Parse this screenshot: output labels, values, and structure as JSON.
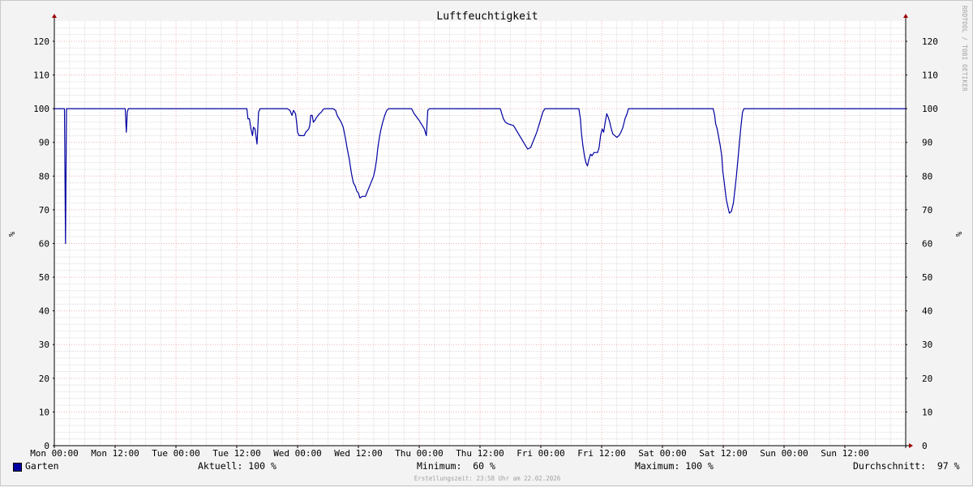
{
  "chart_data": {
    "type": "line",
    "title": "Luftfeuchtigkeit",
    "ylabel": "%",
    "ylim": [
      0,
      126
    ],
    "yticks": [
      0,
      10,
      20,
      30,
      40,
      50,
      60,
      70,
      80,
      90,
      100,
      110,
      120
    ],
    "xlim": [
      0,
      168
    ],
    "xunit": "hours since Mon 00:00",
    "xticks": [
      {
        "x": 0,
        "label": "Mon 00:00"
      },
      {
        "x": 12,
        "label": "Mon 12:00"
      },
      {
        "x": 24,
        "label": "Tue 00:00"
      },
      {
        "x": 36,
        "label": "Tue 12:00"
      },
      {
        "x": 48,
        "label": "Wed 00:00"
      },
      {
        "x": 60,
        "label": "Wed 12:00"
      },
      {
        "x": 72,
        "label": "Thu 00:00"
      },
      {
        "x": 84,
        "label": "Thu 12:00"
      },
      {
        "x": 96,
        "label": "Fri 00:00"
      },
      {
        "x": 108,
        "label": "Fri 12:00"
      },
      {
        "x": 120,
        "label": "Sat 00:00"
      },
      {
        "x": 132,
        "label": "Sat 12:00"
      },
      {
        "x": 144,
        "label": "Sun 00:00"
      },
      {
        "x": 156,
        "label": "Sun 12:00"
      }
    ],
    "grid": true,
    "legend_position": "bottom-left",
    "series": [
      {
        "name": "Garten",
        "color": "#0000a0",
        "points": [
          [
            0,
            100
          ],
          [
            2.0,
            100
          ],
          [
            2.2,
            60
          ],
          [
            2.4,
            100
          ],
          [
            14.0,
            100
          ],
          [
            14.2,
            93
          ],
          [
            14.4,
            99
          ],
          [
            14.6,
            100
          ],
          [
            38.0,
            100
          ],
          [
            38.2,
            97
          ],
          [
            38.5,
            97
          ],
          [
            38.8,
            94
          ],
          [
            39.1,
            92
          ],
          [
            39.3,
            94.5
          ],
          [
            39.6,
            94
          ],
          [
            40.0,
            89.5
          ],
          [
            40.3,
            99
          ],
          [
            40.6,
            100
          ],
          [
            46.0,
            100
          ],
          [
            46.5,
            99.5
          ],
          [
            46.9,
            98
          ],
          [
            47.2,
            99.5
          ],
          [
            47.6,
            98.5
          ],
          [
            47.8,
            96
          ],
          [
            48.0,
            93
          ],
          [
            48.3,
            92
          ],
          [
            49.3,
            92
          ],
          [
            49.6,
            93
          ],
          [
            50.2,
            94
          ],
          [
            50.4,
            95
          ],
          [
            50.6,
            98
          ],
          [
            50.9,
            98
          ],
          [
            51.1,
            96
          ],
          [
            51.4,
            96.5
          ],
          [
            51.8,
            97.5
          ],
          [
            52.3,
            98.5
          ],
          [
            52.7,
            99
          ],
          [
            53.0,
            99.7
          ],
          [
            53.3,
            100
          ],
          [
            55.0,
            100
          ],
          [
            55.5,
            99.5
          ],
          [
            55.8,
            98
          ],
          [
            56.2,
            97
          ],
          [
            56.6,
            96
          ],
          [
            57.0,
            94.5
          ],
          [
            57.4,
            91.5
          ],
          [
            57.8,
            88
          ],
          [
            58.2,
            85
          ],
          [
            58.6,
            81
          ],
          [
            59.0,
            78
          ],
          [
            59.4,
            77
          ],
          [
            59.7,
            75.5
          ],
          [
            60.0,
            75
          ],
          [
            60.3,
            73.5
          ],
          [
            60.8,
            74
          ],
          [
            61.4,
            74
          ],
          [
            61.8,
            75.5
          ],
          [
            62.2,
            77
          ],
          [
            62.6,
            78.5
          ],
          [
            63.0,
            80
          ],
          [
            63.3,
            82
          ],
          [
            63.6,
            85
          ],
          [
            63.8,
            88
          ],
          [
            64.1,
            91
          ],
          [
            64.4,
            93.5
          ],
          [
            64.8,
            96
          ],
          [
            65.2,
            98
          ],
          [
            65.6,
            99.5
          ],
          [
            66.0,
            100
          ],
          [
            70.5,
            100
          ],
          [
            71.0,
            98.5
          ],
          [
            71.5,
            97.5
          ],
          [
            72.0,
            96.5
          ],
          [
            72.6,
            95
          ],
          [
            73.0,
            94
          ],
          [
            73.4,
            92
          ],
          [
            73.7,
            99.5
          ],
          [
            74.0,
            100
          ],
          [
            88.0,
            100
          ],
          [
            88.3,
            98.5
          ],
          [
            88.6,
            97
          ],
          [
            89.0,
            96
          ],
          [
            89.5,
            95.5
          ],
          [
            90.6,
            95
          ],
          [
            91.0,
            94
          ],
          [
            91.4,
            93
          ],
          [
            91.8,
            92
          ],
          [
            92.2,
            91
          ],
          [
            92.6,
            90
          ],
          [
            93.0,
            89
          ],
          [
            93.4,
            88
          ],
          [
            94.0,
            88.5
          ],
          [
            94.4,
            90
          ],
          [
            94.8,
            91.5
          ],
          [
            95.2,
            93
          ],
          [
            95.6,
            95
          ],
          [
            96.0,
            97
          ],
          [
            96.4,
            99
          ],
          [
            96.8,
            100
          ],
          [
            103.5,
            100
          ],
          [
            103.8,
            97
          ],
          [
            104.0,
            93
          ],
          [
            104.3,
            89
          ],
          [
            104.6,
            86
          ],
          [
            104.9,
            84
          ],
          [
            105.2,
            83
          ],
          [
            105.5,
            85
          ],
          [
            105.8,
            86.5
          ],
          [
            106.1,
            86
          ],
          [
            106.5,
            87
          ],
          [
            107.2,
            87
          ],
          [
            107.5,
            88.5
          ],
          [
            107.8,
            92
          ],
          [
            108.1,
            94
          ],
          [
            108.4,
            93
          ],
          [
            108.7,
            96
          ],
          [
            109.0,
            98.5
          ],
          [
            109.3,
            97.5
          ],
          [
            109.6,
            96
          ],
          [
            109.9,
            94
          ],
          [
            110.2,
            92.5
          ],
          [
            110.6,
            92
          ],
          [
            111.0,
            91.5
          ],
          [
            111.4,
            92
          ],
          [
            111.8,
            93
          ],
          [
            112.2,
            94.5
          ],
          [
            112.6,
            97
          ],
          [
            113.0,
            98.5
          ],
          [
            113.3,
            100
          ],
          [
            130.0,
            100
          ],
          [
            130.3,
            98
          ],
          [
            130.5,
            95.5
          ],
          [
            130.8,
            94
          ],
          [
            131.1,
            91.5
          ],
          [
            131.4,
            89
          ],
          [
            131.7,
            86
          ],
          [
            131.9,
            81.5
          ],
          [
            132.2,
            78
          ],
          [
            132.4,
            75.5
          ],
          [
            132.6,
            73
          ],
          [
            132.9,
            71
          ],
          [
            133.2,
            69
          ],
          [
            133.6,
            69.5
          ],
          [
            134.0,
            72
          ],
          [
            134.3,
            76
          ],
          [
            134.6,
            80
          ],
          [
            134.9,
            85
          ],
          [
            135.2,
            90
          ],
          [
            135.5,
            95
          ],
          [
            135.8,
            99
          ],
          [
            136.1,
            100
          ],
          [
            168,
            100
          ]
        ]
      }
    ]
  },
  "legend": {
    "series_name": "Garten",
    "current": "Aktuell: 100 %",
    "minimum": "Minimum:  60 %",
    "maximum": "Maximum: 100 %",
    "average": "Durchschnitt:  97 %"
  },
  "footer": "Erstellungszeit: 23:58 Uhr am 22.02.2026",
  "watermark": "RRDTOOL / TOBI OETIKER",
  "colors": {
    "background": "#f3f3f3",
    "canvas": "#ffffff",
    "major_grid": "#f0b0b0",
    "minor_grid": "#dcdcdc",
    "line": "#0000a0",
    "axis_arrow": "#a00000"
  }
}
